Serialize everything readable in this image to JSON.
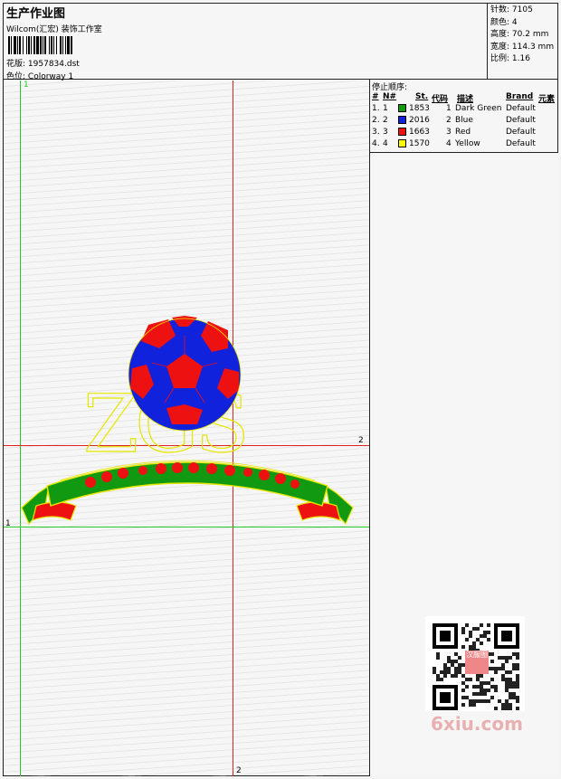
{
  "header": {
    "title": "生产作业图",
    "subtitle": "Wilcom(汇宏) 装饰工作室",
    "design_label": "花版:",
    "design_value": "1957834.dst",
    "colorway_label": "色位:",
    "colorway_value": "Colorway 1"
  },
  "specs": {
    "stitches_label": "针数:",
    "stitches_value": "7105",
    "colors_label": "颜色:",
    "colors_value": "4",
    "height_label": "高度:",
    "height_value": "70.2 mm",
    "width_label": "宽度:",
    "width_value": "114.3 mm",
    "ratio_label": "比例:",
    "ratio_value": "1.16"
  },
  "stop_sequence": {
    "title": "停止顺序:",
    "columns": [
      "#",
      "N#",
      "St.",
      "代码",
      "描述",
      "Brand",
      "元素"
    ],
    "rows": [
      {
        "idx": "1.",
        "n": "1",
        "stitches": "1853",
        "code": "1",
        "desc": "Dark Green",
        "brand": "Default",
        "color": "#119911"
      },
      {
        "idx": "2.",
        "n": "2",
        "stitches": "2016",
        "code": "2",
        "desc": "Blue",
        "brand": "Default",
        "color": "#1122dd"
      },
      {
        "idx": "3.",
        "n": "3",
        "stitches": "1663",
        "code": "3",
        "desc": "Red",
        "brand": "Default",
        "color": "#ee1111"
      },
      {
        "idx": "4.",
        "n": "4",
        "stitches": "1570",
        "code": "4",
        "desc": "Yellow",
        "brand": "Default",
        "color": "#ffff00"
      }
    ]
  },
  "guides": {
    "v1_label": "1",
    "v2_label": "2",
    "h1_label": "1",
    "h2_label": "2"
  },
  "design_art": {
    "lettering": "ZGS"
  },
  "qr_stamp": "汉服图",
  "watermark": "6xiu.com",
  "colors": {
    "guide_green": "#22cc22",
    "guide_red": "#dd2222",
    "watermark": "#e8b0b0"
  }
}
